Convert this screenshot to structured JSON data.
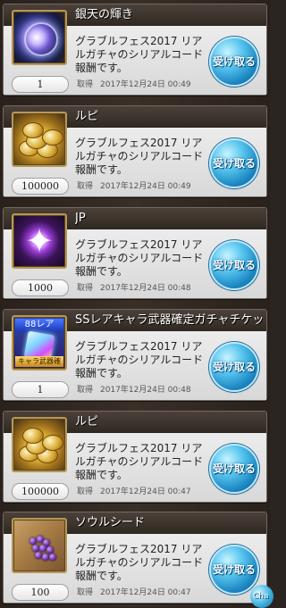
{
  "rewards": [
    {
      "title": "銀天の輝き",
      "description": "グラブルフェス2017 リアルガチャのシリアルコード報酬です。",
      "quantity": "1",
      "date_label": "取得",
      "date": "2017年12月24日 00:49",
      "button_label": "受け取る",
      "icon": "silver-sky-radiance-icon"
    },
    {
      "title": "ルピ",
      "description": "グラブルフェス2017 リアルガチャのシリアルコード報酬です。",
      "quantity": "100000",
      "date_label": "取得",
      "date": "2017年12月24日 00:49",
      "button_label": "受け取る",
      "icon": "rupie-coins-icon"
    },
    {
      "title": "JP",
      "description": "グラブルフェス2017 リアルガチャのシリアルコード報酬です。",
      "quantity": "1000",
      "date_label": "取得",
      "date": "2017年12月24日 00:48",
      "button_label": "受け取る",
      "icon": "jp-crystal-icon"
    },
    {
      "title": "SSレアキャラ武器確定ガチャチケット",
      "description": "グラブルフェス2017 リアルガチャのシリアルコード報酬です。",
      "quantity": "1",
      "date_label": "取得",
      "date": "2017年12月24日 00:48",
      "button_label": "受け取る",
      "icon": "gacha-ticket-icon",
      "thumb_tag": "88レア",
      "thumb_label": "キャラ武器確定"
    },
    {
      "title": "ルピ",
      "description": "グラブルフェス2017 リアルガチャのシリアルコード報酬です。",
      "quantity": "100000",
      "date_label": "取得",
      "date": "2017年12月24日 00:47",
      "button_label": "受け取る",
      "icon": "rupie-coins-icon"
    },
    {
      "title": "ソウルシード",
      "description": "グラブルフェス2017 リアルガチャのシリアルコード報酬です。",
      "quantity": "100",
      "date_label": "取得",
      "date": "2017年12月24日 00:47",
      "button_label": "受け取る",
      "icon": "soul-seed-icon"
    }
  ],
  "chat_badge": "Cha"
}
